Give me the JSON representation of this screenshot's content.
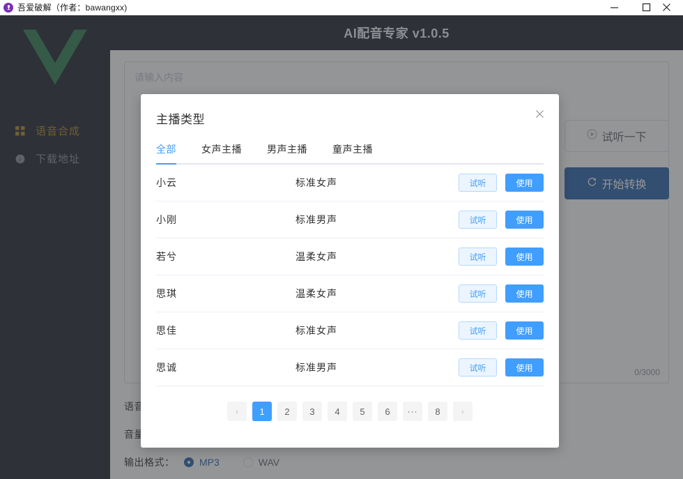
{
  "titlebar": {
    "icon": "microphone-circle-icon",
    "title": "吾爱破解（作者：bawangxx)",
    "minimize": "—",
    "maximize": "□",
    "close": "✕"
  },
  "sidebar": {
    "logo": "vue-logo",
    "items": [
      {
        "label": "语音合成",
        "icon": "grid-icon",
        "active": true
      },
      {
        "label": "下载地址",
        "icon": "info-icon",
        "active": false
      }
    ]
  },
  "header": {
    "title": "AI配音专家 v1.0.5"
  },
  "main": {
    "textarea": {
      "placeholder": "请输入内容",
      "value": "",
      "counter": "0/3000"
    },
    "fields": [
      {
        "label": "语音"
      },
      {
        "label": "音量"
      }
    ],
    "output_format": {
      "label": "输出格式：",
      "options": [
        {
          "label": "MP3",
          "selected": true
        },
        {
          "label": "WAV",
          "selected": false
        }
      ]
    },
    "buttons": {
      "preview": {
        "label": "试听一下",
        "icon": "play-circle-icon"
      },
      "convert": {
        "label": "开始转换",
        "icon": "refresh-icon"
      }
    }
  },
  "modal": {
    "title": "主播类型",
    "close_icon": "close-icon",
    "tabs": [
      {
        "label": "全部",
        "active": true
      },
      {
        "label": "女声主播",
        "active": false
      },
      {
        "label": "男声主播",
        "active": false
      },
      {
        "label": "童声主播",
        "active": false
      }
    ],
    "actions": {
      "try": "试听",
      "use": "使用"
    },
    "rows": [
      {
        "name": "小云",
        "type": "标准女声"
      },
      {
        "name": "小刚",
        "type": "标准男声"
      },
      {
        "name": "若兮",
        "type": "温柔女声"
      },
      {
        "name": "思琪",
        "type": "温柔女声"
      },
      {
        "name": "思佳",
        "type": "标准女声"
      },
      {
        "name": "思诚",
        "type": "标准男声"
      }
    ],
    "pagination": {
      "prev": "‹",
      "next": "›",
      "pages": [
        "1",
        "2",
        "3",
        "4",
        "5",
        "6",
        "···",
        "8"
      ],
      "current": "1"
    }
  },
  "colors": {
    "accent_blue": "#409eff",
    "dark_panel": "#1d222b",
    "active_nav": "#b08628",
    "convert_blue": "#2662a8",
    "vue_green": "#2e7d4f"
  }
}
